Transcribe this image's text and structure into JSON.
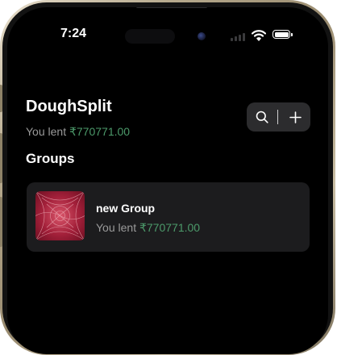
{
  "status_bar": {
    "time": "7:24",
    "icons": [
      "cellular-signal-icon",
      "wifi-icon",
      "battery-icon"
    ]
  },
  "app": {
    "title": "DoughSplit",
    "summary": {
      "prefix": "You lent ",
      "amount": "₹770771.00"
    },
    "actions": {
      "search_icon": "search-icon",
      "add_icon": "plus-icon"
    }
  },
  "groups_section": {
    "title": "Groups",
    "items": [
      {
        "name": "new Group",
        "lent_prefix": "You lent ",
        "lent_amount": "₹770771.00",
        "thumbnail": "group-image"
      }
    ]
  },
  "colors": {
    "background": "#000000",
    "card": "#1c1c1e",
    "button_bg": "#2c2c2e",
    "positive_amount": "#4c9a6a",
    "secondary_text": "#9a9a9a",
    "thumbnail_red": "#a3203a"
  }
}
